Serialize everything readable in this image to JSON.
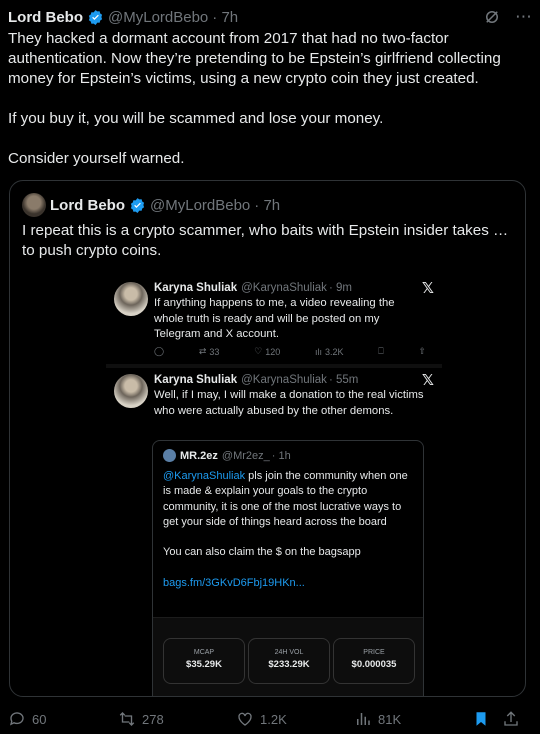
{
  "tweet": {
    "author_name": "Lord Bebo",
    "handle": "@MyLordBebo",
    "time": "· 7h",
    "paragraphs": [
      "They hacked a dormant account from 2017 that had no two-factor authentication. Now they’re pretending to be Epstein’s girlfriend collecting money for Epstein’s victims, using a new crypto coin they just created.",
      "If you buy it, you will be scammed and lose your money.",
      "Consider yourself warned."
    ],
    "verified_color": "#1d9bf0",
    "accent_color": "#1d9bf0"
  },
  "quote": {
    "author_name": "Lord Bebo",
    "handle": "@MyLordBebo",
    "time": "· 7h",
    "text": "I repeat this is a crypto scammer, who baits with Epstein insider takes … to push crypto coins."
  },
  "embedded": {
    "post1": {
      "name": "Karyna Shuliak",
      "handle": "@KarynaShuliak",
      "time": "· 9m",
      "text": "If anything happens to me, a video revealing the whole truth is ready and will be posted on my Telegram and X account.",
      "retweets": "33",
      "likes": "120",
      "views": "3.2K"
    },
    "post2": {
      "name": "Karyna Shuliak",
      "handle": "@KarynaShuliak",
      "time": "· 55m",
      "text": "Well, if I may, I will make a donation to the real victims who were actually abused by the other demons."
    },
    "inner_quote": {
      "name": "MR.2ez",
      "handle": "@Mr2ez_",
      "time": "· 1h",
      "mention": "@KarynaShuliak",
      "text1": " pls join the community when one is made & explain your goals to the crypto community, it is one of the most lucrative ways to get your side of things heard across the board",
      "text2": "You can also claim the $ on the bagsapp",
      "link": "bags.fm/3GKvD6Fbj19HKn..."
    },
    "stats": [
      {
        "label": "MCAP",
        "value": "$35.29K"
      },
      {
        "label": "24H VOL",
        "value": "$233.29K"
      },
      {
        "label": "PRICE",
        "value": "$0.000035"
      }
    ]
  },
  "actions": {
    "replies": "60",
    "reposts": "278",
    "likes": "1.2K",
    "views": "81K"
  }
}
